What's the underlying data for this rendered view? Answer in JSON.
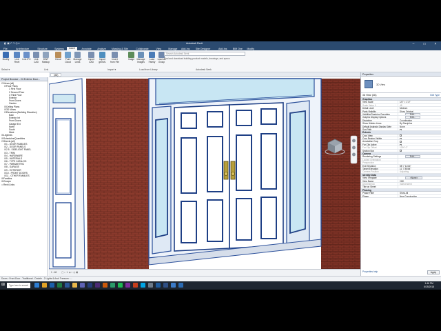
{
  "titlebar": {
    "tabs": [
      "File",
      "Architecture",
      "Structure",
      "Systems",
      "Insert",
      "Annotate",
      "Analyze",
      "Massing & Site",
      "Collaborate",
      "View",
      "Manage",
      "Add-Ins",
      "Site Designer",
      "Add-Ins",
      "BIM One",
      "Modify"
    ],
    "active_tab": "Insert",
    "title": "Autodesk Revit",
    "min": "–",
    "max": "□",
    "close": "×"
  },
  "ribbon": {
    "buttons": [
      {
        "label": "Modify",
        "color": "#3a6db3"
      },
      {
        "label": "Link Revit",
        "color": "#5a86c2"
      },
      {
        "label": "Link IFC",
        "color": "#6b90c8"
      },
      {
        "label": "Link CAD",
        "color": "#7a8fb0"
      },
      {
        "label": "DWF Markup",
        "color": "#8fa3bd"
      },
      {
        "label": "Decal",
        "color": "#b98d58"
      },
      {
        "label": "Point Cloud",
        "color": "#6fa0cc"
      },
      {
        "label": "Manage Links",
        "color": "#7f96b6"
      },
      {
        "label": "Import CAD",
        "color": "#7a8fb0"
      },
      {
        "label": "Import gbXML",
        "color": "#4f8fbf"
      },
      {
        "label": "Insert from File",
        "color": "#7a8fb0"
      },
      {
        "label": "Image",
        "color": "#5d8c5a"
      },
      {
        "label": "Manage Images",
        "color": "#6a90b8"
      },
      {
        "label": "Load Family",
        "color": "#4c7db8"
      },
      {
        "label": "Load as Group",
        "color": "#6f87ac"
      }
    ],
    "panels": [
      "Select ▾",
      "Link",
      "Import ▾",
      "Load from Library",
      "Autodesk Seek"
    ],
    "seek_placeholder": "Search Autodesk Seek",
    "seek_text": "Find and download building product models, drawings, and specs"
  },
  "project_browser": {
    "title": "Project Browser - 24 Exterior Door...",
    "items": [
      {
        "label": "Views (all)",
        "level": 0,
        "exp": "⊟"
      },
      {
        "label": "Floor Plans",
        "level": 1,
        "exp": "⊟"
      },
      {
        "label": "1 First Floor",
        "level": 2,
        "exp": ""
      },
      {
        "label": "2 Second Floor",
        "level": 2,
        "exp": ""
      },
      {
        "label": "3 Third Floor",
        "level": 2,
        "exp": ""
      },
      {
        "label": "Exterior",
        "level": 2,
        "exp": ""
      },
      {
        "label": "Front Doors",
        "level": 2,
        "exp": ""
      },
      {
        "label": "Garden",
        "level": 2,
        "exp": ""
      },
      {
        "label": "Ceiling Plans",
        "level": 1,
        "exp": "⊞"
      },
      {
        "label": "3D Views",
        "level": 1,
        "exp": "⊞"
      },
      {
        "label": "Elevations (Building Elevation)",
        "level": 1,
        "exp": "⊟"
      },
      {
        "label": "East",
        "level": 2,
        "exp": ""
      },
      {
        "label": "Exterior Int",
        "level": 2,
        "exp": ""
      },
      {
        "label": "Front Doors",
        "level": 2,
        "exp": ""
      },
      {
        "label": "Garage Ext",
        "level": 2,
        "exp": ""
      },
      {
        "label": "North",
        "level": 2,
        "exp": ""
      },
      {
        "label": "South",
        "level": 2,
        "exp": ""
      },
      {
        "label": "West",
        "level": 2,
        "exp": ""
      },
      {
        "label": "Legends",
        "level": 0,
        "exp": "⊞"
      },
      {
        "label": "Schedules/Quantities",
        "level": 0,
        "exp": "⊞"
      },
      {
        "label": "Sheets (all)",
        "level": 0,
        "exp": "⊟"
      },
      {
        "label": "1 - DOOR FAMILIES",
        "level": 1,
        "exp": "⊞"
      },
      {
        "label": "2 - DOOR PANELS",
        "level": 1,
        "exp": "⊞"
      },
      {
        "label": "2.5 - SIDELIGHT PANEL",
        "level": 1,
        "exp": "⊞"
      },
      {
        "label": "3 - TRIM",
        "level": 1,
        "exp": "⊞"
      },
      {
        "label": "4 - HARDWARE",
        "level": 1,
        "exp": "⊞"
      },
      {
        "label": "5 - MATERIALS",
        "level": 1,
        "exp": "⊞"
      },
      {
        "label": "6 - TYPE CATALOG",
        "level": 1,
        "exp": "⊞"
      },
      {
        "label": "7 - PARAMETRIC",
        "level": 1,
        "exp": "⊞"
      },
      {
        "label": "8 - GARAGE",
        "level": 1,
        "exp": "⊞"
      },
      {
        "label": "9 - EXTERIOR",
        "level": 1,
        "exp": "⊞"
      },
      {
        "label": "10 - FRONT DOORS",
        "level": 1,
        "exp": "⊞"
      },
      {
        "label": "11 - OTHER FAMILIES",
        "level": 1,
        "exp": "⊞"
      },
      {
        "label": "Families",
        "level": 0,
        "exp": "⊞"
      },
      {
        "label": "Groups",
        "level": 0,
        "exp": "⊞"
      },
      {
        "label": "Revit Links",
        "level": 0,
        "exp": "∞"
      }
    ]
  },
  "view_tab": "{3D}",
  "view_controls": "1 : 48",
  "properties": {
    "title": "Properties",
    "type_name": "3D View",
    "selector": "3D View: {3D}",
    "edit_type": "Edit Type",
    "sections": [
      {
        "name": "Graphics",
        "rows": [
          {
            "k": "View Scale",
            "v": "1/4\" = 1'-0\""
          },
          {
            "k": "Scale Value 1:",
            "v": "48",
            "dim": true
          },
          {
            "k": "Detail Level",
            "v": "Medium"
          },
          {
            "k": "Parts Visibility",
            "v": "Show Original"
          },
          {
            "k": "Visibility/Graphics Overrides",
            "v": "Edit...",
            "btn": true
          },
          {
            "k": "Graphic Display Options",
            "v": "Edit...",
            "btn": true
          },
          {
            "k": "Discipline",
            "v": "Coordination"
          },
          {
            "k": "Show Hidden Lines",
            "v": "By Discipline"
          },
          {
            "k": "Default Analysis Display Style",
            "v": "None"
          },
          {
            "k": "Sun Path",
            "v": "",
            "chk": true
          }
        ]
      },
      {
        "name": "Extents",
        "rows": [
          {
            "k": "Crop View",
            "v": "",
            "chk": true
          },
          {
            "k": "Crop Region Visible",
            "v": "",
            "chk": true
          },
          {
            "k": "Annotation Crop",
            "v": "",
            "chk": true
          },
          {
            "k": "Far Clip Active",
            "v": "",
            "chk": true
          },
          {
            "k": "Far Clip Offset",
            "v": "1000' 0\"",
            "dim": true
          },
          {
            "k": "Section Box",
            "v": "",
            "chk": true
          }
        ]
      },
      {
        "name": "Camera",
        "rows": [
          {
            "k": "Rendering Settings",
            "v": "Edit...",
            "btn": true
          },
          {
            "k": "Locked Orientation",
            "v": "",
            "dim": true
          },
          {
            "k": "Perspective",
            "v": "",
            "dim": true
          },
          {
            "k": "Eye Elevation",
            "v": "58' 7 11/16\""
          },
          {
            "k": "Target Elevation",
            "v": "11' 7 85/64\""
          },
          {
            "k": "Camera Position",
            "v": "Adjusting",
            "dim": true
          }
        ]
      },
      {
        "name": "Identity Data",
        "rows": [
          {
            "k": "View Template",
            "v": "<None>",
            "btn": true
          },
          {
            "k": "View Name",
            "v": "{3D}"
          },
          {
            "k": "Dependency",
            "v": "Independent",
            "dim": true
          },
          {
            "k": "Title on Sheet",
            "v": ""
          }
        ]
      },
      {
        "name": "Phasing",
        "rows": [
          {
            "k": "Phase Filter",
            "v": "Show All"
          },
          {
            "k": "Phase",
            "v": "New Construction"
          }
        ]
      }
    ],
    "help": "Properties help",
    "apply": "Apply"
  },
  "status_text": "Doors : Front Door - Traditional - Double - 2 Lights & Arch Transom : ...",
  "taskbar": {
    "search_placeholder": "Type here to search",
    "time": "1:46 PM",
    "date": "6/25/2018",
    "icons": [
      {
        "name": "edge-icon",
        "color": "#2d7dd2"
      },
      {
        "name": "chrome-icon",
        "color": "#e0a126"
      },
      {
        "name": "outlook-icon",
        "color": "#1b5fad"
      },
      {
        "name": "excel-icon",
        "color": "#1f7a43"
      },
      {
        "name": "word-icon",
        "color": "#2b5797"
      },
      {
        "name": "folder-icon",
        "color": "#e8b74b"
      },
      {
        "name": "teams-icon",
        "color": "#5d62b5"
      },
      {
        "name": "photoshop-icon",
        "color": "#243c7a"
      },
      {
        "name": "premiere-icon",
        "color": "#4a2a74"
      },
      {
        "name": "illustrator-icon",
        "color": "#c9580b"
      },
      {
        "name": "camtasia-icon",
        "color": "#2a9b6a"
      },
      {
        "name": "spotify-icon",
        "color": "#1db954"
      },
      {
        "name": "onenote-icon",
        "color": "#7b2c9c"
      },
      {
        "name": "powerpoint-icon",
        "color": "#c43e1c"
      },
      {
        "name": "skype-icon",
        "color": "#00a4e4"
      },
      {
        "name": "store-icon",
        "color": "#6c7a89"
      },
      {
        "name": "revit-icon",
        "color": "#1e5a9c"
      },
      {
        "name": "revit-icon-2",
        "color": "#2f4f84"
      },
      {
        "name": "mail-icon",
        "color": "#3b7bc8"
      },
      {
        "name": "calendar-icon",
        "color": "#2a6ab2"
      }
    ]
  }
}
